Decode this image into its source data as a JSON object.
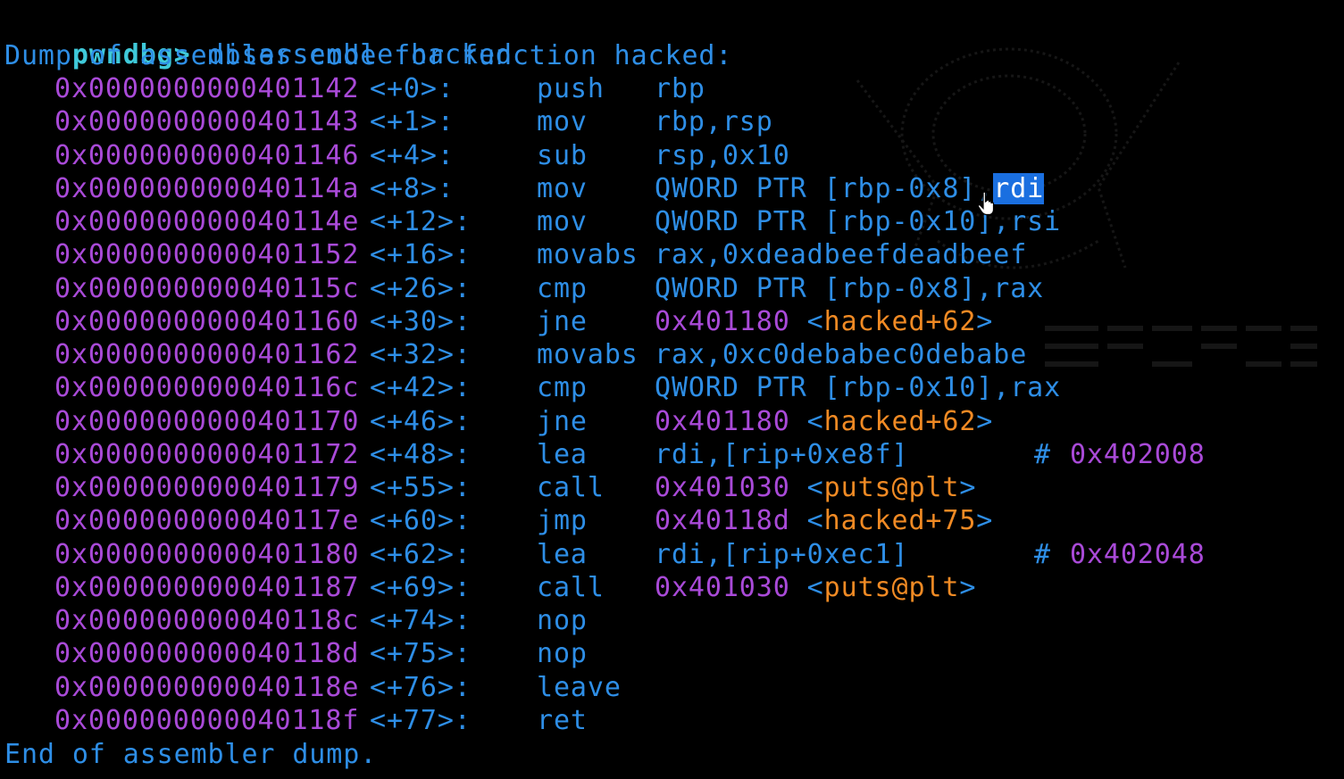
{
  "terminal": {
    "prompt": "pwndbg>",
    "command": " disassemble hacked",
    "header": "Dump of assembler code for function hacked:",
    "footer": "End of assembler dump.",
    "selection_text": "rdi",
    "lines": [
      {
        "addr": "0x0000000000401142",
        "offset": "<+0>:",
        "mnemonic": "push",
        "operands": "rbp"
      },
      {
        "addr": "0x0000000000401143",
        "offset": "<+1>:",
        "mnemonic": "mov",
        "operands": "rbp,rsp"
      },
      {
        "addr": "0x0000000000401146",
        "offset": "<+4>:",
        "mnemonic": "sub",
        "operands": "rsp,0x10"
      },
      {
        "addr": "0x000000000040114a",
        "offset": "<+8>:",
        "mnemonic": "mov",
        "operands": "QWORD PTR [rbp-0x8],",
        "selected": "rdi"
      },
      {
        "addr": "0x000000000040114e",
        "offset": "<+12>:",
        "mnemonic": "mov",
        "operands": "QWORD PTR [rbp-0x10],rsi"
      },
      {
        "addr": "0x0000000000401152",
        "offset": "<+16>:",
        "mnemonic": "movabs",
        "operands": "rax,0xdeadbeefdeadbeef"
      },
      {
        "addr": "0x000000000040115c",
        "offset": "<+26>:",
        "mnemonic": "cmp",
        "operands": "QWORD PTR [rbp-0x8],rax"
      },
      {
        "addr": "0x0000000000401160",
        "offset": "<+30>:",
        "mnemonic": "jne",
        "target": "0x401180",
        "sym": "hacked+62"
      },
      {
        "addr": "0x0000000000401162",
        "offset": "<+32>:",
        "mnemonic": "movabs",
        "operands": "rax,0xc0debabec0debabe"
      },
      {
        "addr": "0x000000000040116c",
        "offset": "<+42>:",
        "mnemonic": "cmp",
        "operands": "QWORD PTR [rbp-0x10],rax"
      },
      {
        "addr": "0x0000000000401170",
        "offset": "<+46>:",
        "mnemonic": "jne",
        "target": "0x401180",
        "sym": "hacked+62"
      },
      {
        "addr": "0x0000000000401172",
        "offset": "<+48>:",
        "mnemonic": "lea",
        "operands": "rdi,[rip+0xe8f]",
        "comment_hash": "#",
        "comment_addr": "0x402008"
      },
      {
        "addr": "0x0000000000401179",
        "offset": "<+55>:",
        "mnemonic": "call",
        "target": "0x401030",
        "sym": "puts@plt"
      },
      {
        "addr": "0x000000000040117e",
        "offset": "<+60>:",
        "mnemonic": "jmp",
        "target": "0x40118d",
        "sym": "hacked+75"
      },
      {
        "addr": "0x0000000000401180",
        "offset": "<+62>:",
        "mnemonic": "lea",
        "operands": "rdi,[rip+0xec1]",
        "comment_hash": "#",
        "comment_addr": "0x402048"
      },
      {
        "addr": "0x0000000000401187",
        "offset": "<+69>:",
        "mnemonic": "call",
        "target": "0x401030",
        "sym": "puts@plt"
      },
      {
        "addr": "0x000000000040118c",
        "offset": "<+74>:",
        "mnemonic": "nop"
      },
      {
        "addr": "0x000000000040118d",
        "offset": "<+75>:",
        "mnemonic": "nop"
      },
      {
        "addr": "0x000000000040118e",
        "offset": "<+76>:",
        "mnemonic": "leave"
      },
      {
        "addr": "0x000000000040118f",
        "offset": "<+77>:",
        "mnemonic": "ret"
      }
    ]
  },
  "colors": {
    "background": "#000000",
    "prompt": "#3fc9d9",
    "text_blue": "#2e8ee6",
    "address_purple": "#a94ad8",
    "symbol_orange": "#f08a24",
    "selection": "#1a6fe0"
  },
  "icons": {
    "cursor": "hand-pointer-icon",
    "background_art": "pwndbg-logo-watermark"
  }
}
